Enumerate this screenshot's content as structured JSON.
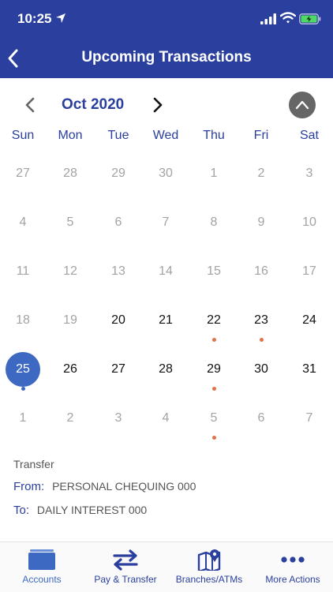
{
  "status_bar": {
    "time": "10:25"
  },
  "header": {
    "title": "Upcoming Transactions"
  },
  "calendar": {
    "month_label": "Oct 2020",
    "weekdays": [
      "Sun",
      "Mon",
      "Tue",
      "Wed",
      "Thu",
      "Fri",
      "Sat"
    ],
    "weeks": [
      [
        {
          "d": "27",
          "in": false
        },
        {
          "d": "28",
          "in": false
        },
        {
          "d": "29",
          "in": false
        },
        {
          "d": "30",
          "in": false
        },
        {
          "d": "1",
          "in": false
        },
        {
          "d": "2",
          "in": false
        },
        {
          "d": "3",
          "in": false
        }
      ],
      [
        {
          "d": "4",
          "in": false
        },
        {
          "d": "5",
          "in": false
        },
        {
          "d": "6",
          "in": false
        },
        {
          "d": "7",
          "in": false
        },
        {
          "d": "8",
          "in": false
        },
        {
          "d": "9",
          "in": false
        },
        {
          "d": "10",
          "in": false
        }
      ],
      [
        {
          "d": "11",
          "in": false
        },
        {
          "d": "12",
          "in": false
        },
        {
          "d": "13",
          "in": false
        },
        {
          "d": "14",
          "in": false
        },
        {
          "d": "15",
          "in": false
        },
        {
          "d": "16",
          "in": false
        },
        {
          "d": "17",
          "in": false
        }
      ],
      [
        {
          "d": "18",
          "in": false
        },
        {
          "d": "19",
          "in": false
        },
        {
          "d": "20",
          "in": true
        },
        {
          "d": "21",
          "in": true
        },
        {
          "d": "22",
          "in": true,
          "dot": "orange"
        },
        {
          "d": "23",
          "in": true,
          "dot": "orange"
        },
        {
          "d": "24",
          "in": true
        }
      ],
      [
        {
          "d": "25",
          "in": true,
          "today": true,
          "dot": "blue"
        },
        {
          "d": "26",
          "in": true
        },
        {
          "d": "27",
          "in": true
        },
        {
          "d": "28",
          "in": true
        },
        {
          "d": "29",
          "in": true,
          "dot": "orange"
        },
        {
          "d": "30",
          "in": true
        },
        {
          "d": "31",
          "in": true
        }
      ],
      [
        {
          "d": "1",
          "in": false
        },
        {
          "d": "2",
          "in": false
        },
        {
          "d": "3",
          "in": false
        },
        {
          "d": "4",
          "in": false
        },
        {
          "d": "5",
          "in": false,
          "dot": "orange"
        },
        {
          "d": "6",
          "in": false
        },
        {
          "d": "7",
          "in": false
        }
      ]
    ]
  },
  "transaction": {
    "type": "Transfer",
    "from_label": "From:",
    "from_value": "PERSONAL CHEQUING 000",
    "to_label": "To:",
    "to_value": "DAILY INTEREST 000"
  },
  "tabs": [
    {
      "label": "Accounts",
      "icon": "wallet-icon",
      "selected": true
    },
    {
      "label": "Pay & Transfer",
      "icon": "transfer-arrows-icon",
      "selected": false
    },
    {
      "label": "Branches/ATMs",
      "icon": "map-pin-icon",
      "selected": false
    },
    {
      "label": "More Actions",
      "icon": "more-dots-icon",
      "selected": false
    }
  ],
  "colors": {
    "brand": "#2a3f9e",
    "today": "#3d69c3",
    "dot_orange": "#e0734a",
    "dot_blue": "#3d69c3",
    "dim_text": "#a3a3a3"
  }
}
